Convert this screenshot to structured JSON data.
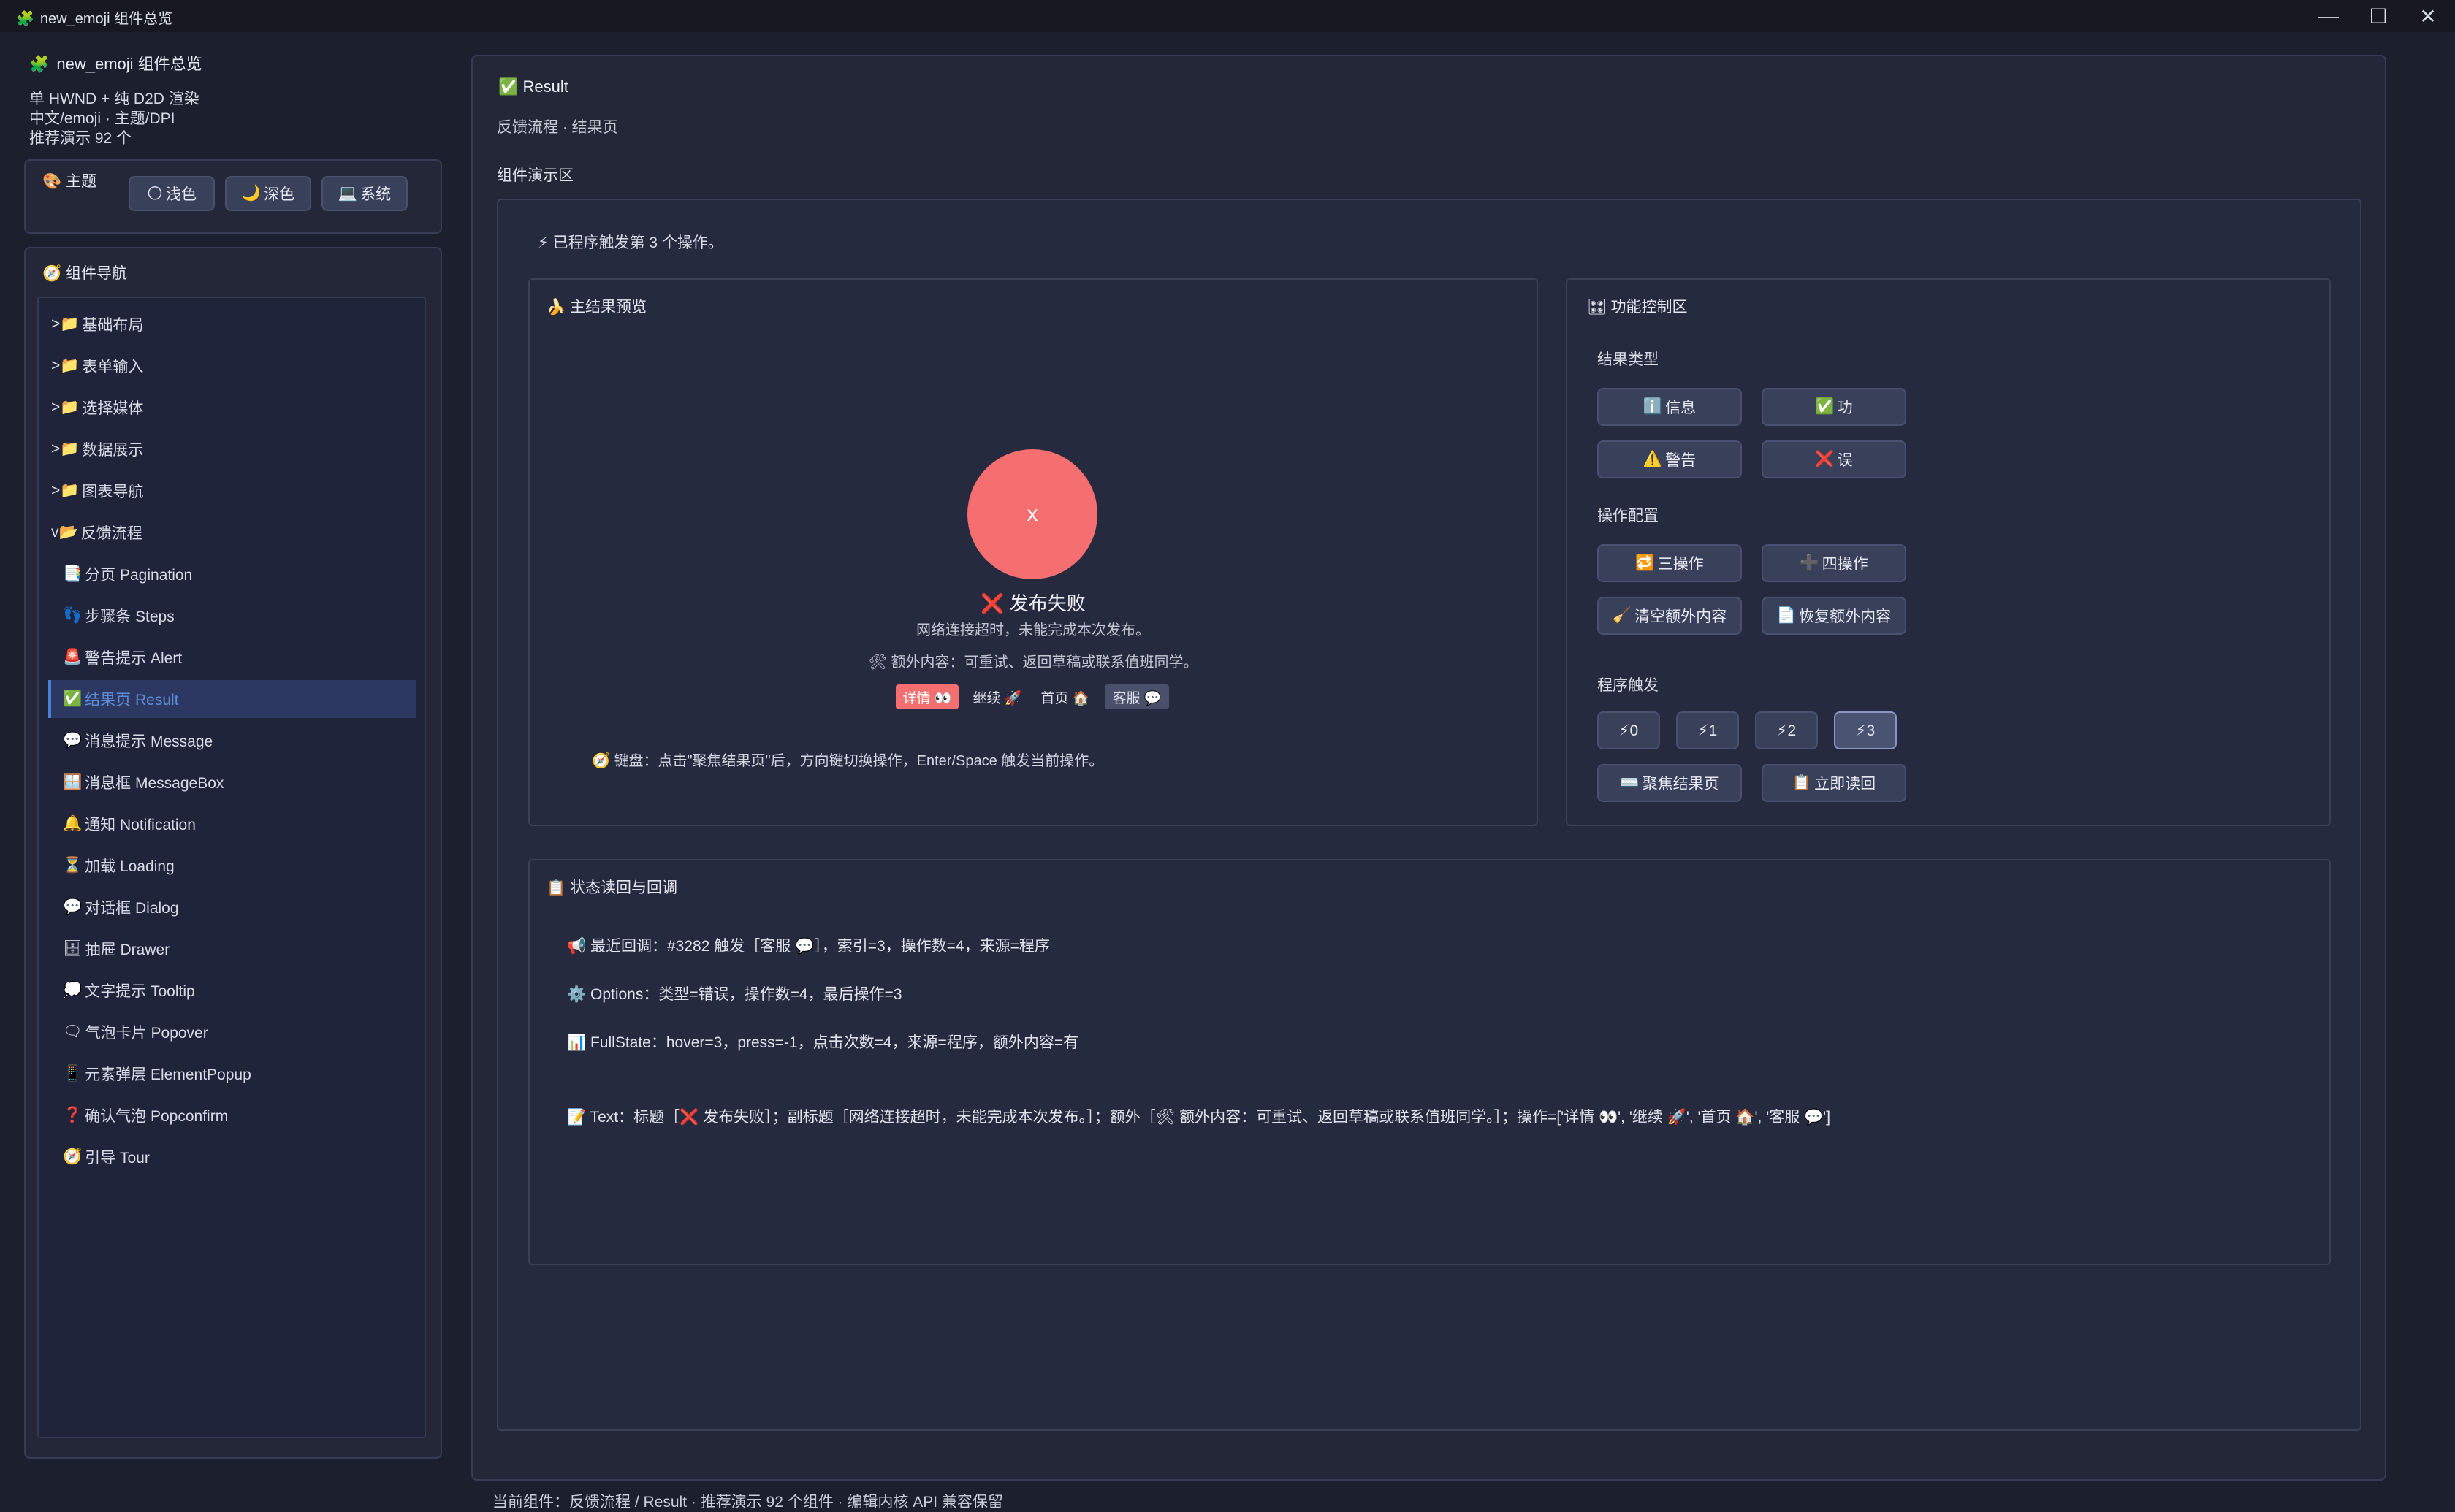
{
  "window": {
    "title": "new_emoji 组件总览",
    "icon": "🧩",
    "minimize_glyph": "—",
    "maximize_glyph": "☐",
    "close_glyph": "✕"
  },
  "sidebar": {
    "app_title": "new_emoji 组件总览",
    "subtitle": [
      "单 HWND + 纯 D2D 渲染",
      "中文/emoji · 主题/DPI",
      "推荐演示 92 个"
    ],
    "theme": {
      "label": "主题",
      "icon": "🎨",
      "options": [
        {
          "icon": "🌕",
          "label": "浅色"
        },
        {
          "icon": "🌙",
          "label": "深色"
        },
        {
          "icon": "💻",
          "label": "系统"
        }
      ]
    },
    "nav": {
      "title": "组件导航",
      "icon": "🧭",
      "groups": [
        {
          "prefix": ">",
          "icon": "📁",
          "label": "基础布局"
        },
        {
          "prefix": ">",
          "icon": "📁",
          "label": "表单输入"
        },
        {
          "prefix": ">",
          "icon": "📁",
          "label": "选择媒体"
        },
        {
          "prefix": ">",
          "icon": "📁",
          "label": "数据展示"
        },
        {
          "prefix": ">",
          "icon": "📁",
          "label": "图表导航"
        },
        {
          "prefix": "v",
          "icon": "📂",
          "label": "反馈流程"
        }
      ],
      "items": [
        {
          "icon": "📑",
          "label": "分页 Pagination"
        },
        {
          "icon": "👣",
          "label": "步骤条 Steps"
        },
        {
          "icon": "🚨",
          "label": "警告提示 Alert"
        },
        {
          "icon": "✅",
          "label": "结果页 Result"
        },
        {
          "icon": "💬",
          "label": "消息提示 Message"
        },
        {
          "icon": "🪟",
          "label": "消息框 MessageBox"
        },
        {
          "icon": "🔔",
          "label": "通知 Notification"
        },
        {
          "icon": "⏳",
          "label": "加载 Loading"
        },
        {
          "icon": "💬",
          "label": "对话框 Dialog"
        },
        {
          "icon": "🗄",
          "label": "抽屉 Drawer"
        },
        {
          "icon": "💭",
          "label": "文字提示 Tooltip"
        },
        {
          "icon": "🗨",
          "label": "气泡卡片 Popover"
        },
        {
          "icon": "📱",
          "label": "元素弹层 ElementPopup"
        },
        {
          "icon": "❓",
          "label": "确认气泡 Popconfirm"
        },
        {
          "icon": "🧭",
          "label": "引导 Tour"
        }
      ],
      "active_index": 3
    }
  },
  "main": {
    "title": "Result",
    "title_icon": "✅",
    "subtitle": "反馈流程 · 结果页",
    "demo_label": "组件演示区",
    "trigger_note": "⚡ 已程序触发第 3 个操作。",
    "preview": {
      "title": "🍌 主结果预览",
      "circle_glyph": "x",
      "result_title": "❌ 发布失败",
      "result_subtitle": "网络连接超时，未能完成本次发布。",
      "extra": "🛠 额外内容：可重试、返回草稿或联系值班同学。",
      "actions": [
        "详情 👀",
        "继续 🚀",
        "首页 🏠",
        "客服 💬"
      ],
      "keyboard_hint": "🧭 键盘：点击\"聚焦结果页\"后，方向键切换操作，Enter/Space 触发当前操作。"
    },
    "controls": {
      "title": "🎛 功能控制区",
      "result_type_label": "结果类型",
      "result_types": [
        {
          "icon": "ℹ️",
          "label": "信息"
        },
        {
          "icon": "✅",
          "label": "功"
        },
        {
          "icon": "⚠️",
          "label": "警告"
        },
        {
          "icon": "❌",
          "label": "误"
        }
      ],
      "action_config_label": "操作配置",
      "action_configs": [
        {
          "icon": "🔁",
          "label": "三操作"
        },
        {
          "icon": "➕",
          "label": "四操作"
        },
        {
          "icon": "🧹",
          "label": "清空额外内容"
        },
        {
          "icon": "📄",
          "label": "恢复额外内容"
        }
      ],
      "trigger_label": "程序触发",
      "triggers": [
        "⚡0",
        "⚡1",
        "⚡2",
        "⚡3"
      ],
      "selected_trigger": 3,
      "bottom_buttons": [
        {
          "icon": "⌨️",
          "label": "聚焦结果页"
        },
        {
          "icon": "📋",
          "label": "立即读回"
        }
      ]
    },
    "status": {
      "title": "📋 状态读回与回调",
      "lines": [
        "📢 最近回调：#3282 触发［客服 💬］，索引=3，操作数=4，来源=程序",
        "⚙️ Options：类型=错误，操作数=4，最后操作=3",
        "📊 FullState：hover=3，press=-1，点击次数=4，来源=程序，额外内容=有",
        "📝 Text：标题［❌ 发布失败］；副标题［网络连接超时，未能完成本次发布。］；额外［🛠 额外内容：可重试、返回草稿或联系值班同学。］；操作=['详情 👀', '继续 🚀', '首页 🏠', '客服 💬']"
      ]
    }
  },
  "footer": "当前组件：反馈流程 / Result · 推荐演示 92 个组件 · 编辑内核 API 兼容保留"
}
